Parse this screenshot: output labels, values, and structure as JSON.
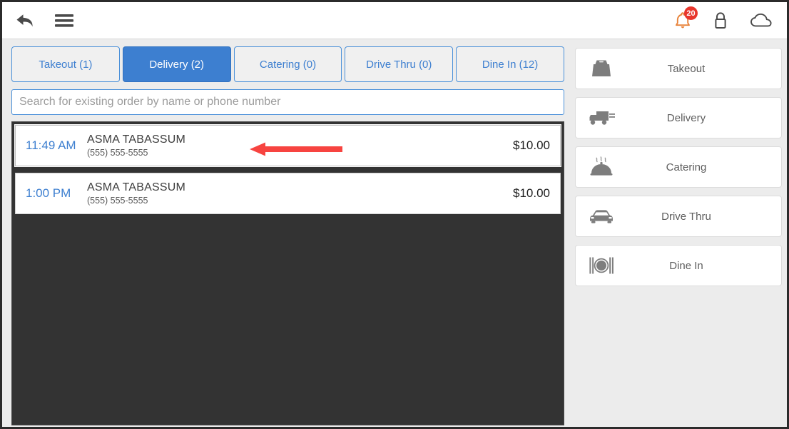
{
  "header": {
    "back_icon": "back-arrow-icon",
    "menu_icon": "hamburger-menu-icon",
    "notifications_icon": "bell-icon",
    "notifications_count": "20",
    "lock_icon": "lock-icon",
    "cloud_icon": "cloud-icon",
    "badge_color": "#e8362c",
    "bell_color": "#e8833a"
  },
  "tabs": [
    {
      "label": "Takeout (1)",
      "active": false
    },
    {
      "label": "Delivery (2)",
      "active": true
    },
    {
      "label": "Catering (0)",
      "active": false
    },
    {
      "label": "Drive Thru (0)",
      "active": false
    },
    {
      "label": "Dine In (12)",
      "active": false
    }
  ],
  "search": {
    "placeholder": "Search for existing order by name or phone number",
    "value": ""
  },
  "orders": [
    {
      "time": "11:49 AM",
      "name": "ASMA TABASSUM",
      "phone": "(555) 555-5555",
      "price": "$10.00",
      "selected": true,
      "annotated": true
    },
    {
      "time": "1:00 PM",
      "name": "ASMA TABASSUM",
      "phone": "(555) 555-5555",
      "price": "$10.00",
      "selected": false,
      "annotated": false
    }
  ],
  "annotation": {
    "type": "arrow-left",
    "color": "#f74440"
  },
  "sidebar": {
    "buttons": [
      {
        "label": "Takeout",
        "icon": "takeout-bag-icon"
      },
      {
        "label": "Delivery",
        "icon": "delivery-truck-icon"
      },
      {
        "label": "Catering",
        "icon": "catering-cloche-icon"
      },
      {
        "label": "Drive Thru",
        "icon": "car-icon"
      },
      {
        "label": "Dine In",
        "icon": "plate-utensils-icon"
      }
    ]
  },
  "colors": {
    "accent_blue": "#3d7fd0",
    "list_background": "#333333",
    "panel_background": "#ececec"
  }
}
